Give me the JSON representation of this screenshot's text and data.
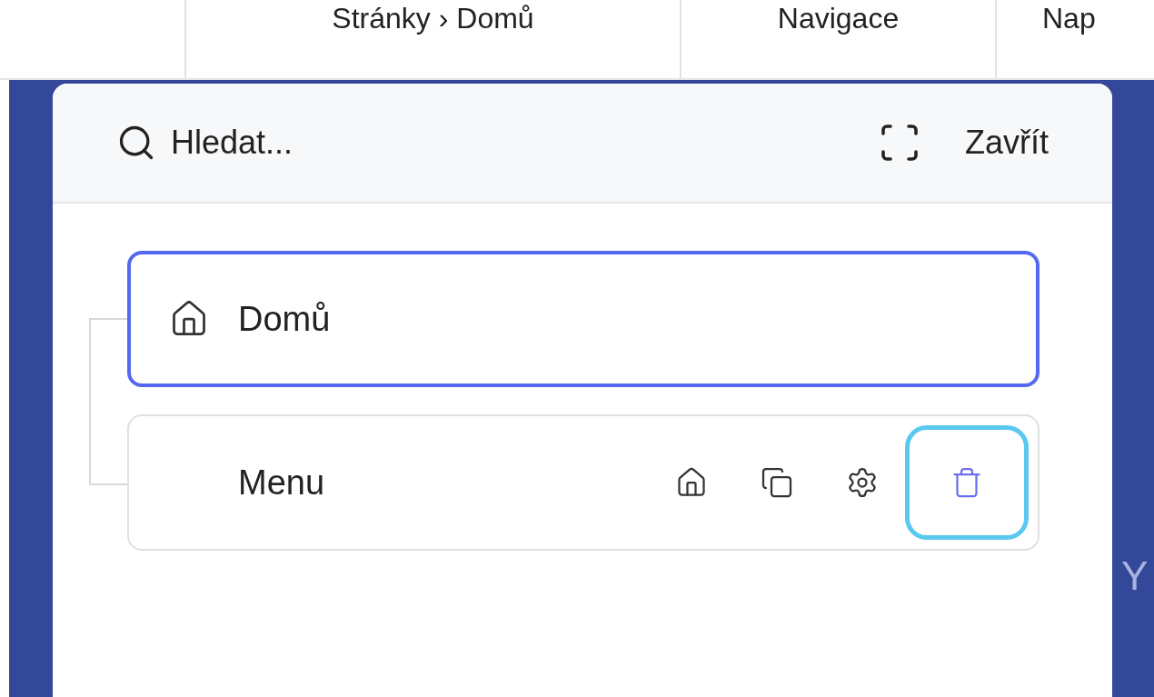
{
  "top_bar": {
    "columns": [
      "Stránky › Domů",
      "Navigace",
      "Nap"
    ]
  },
  "background": {
    "text": "Y"
  },
  "panel": {
    "search": {
      "placeholder": "Hledat..."
    },
    "close_label": "Zavřít",
    "tree": [
      {
        "label": "Domů",
        "selected": true,
        "kind": "home"
      },
      {
        "label": "Menu",
        "selected": false,
        "kind": "plain",
        "actions": [
          {
            "kind": "home",
            "focused": false
          },
          {
            "kind": "copy",
            "focused": false
          },
          {
            "kind": "settings",
            "focused": false
          },
          {
            "kind": "delete",
            "focused": true
          }
        ]
      }
    ]
  }
}
